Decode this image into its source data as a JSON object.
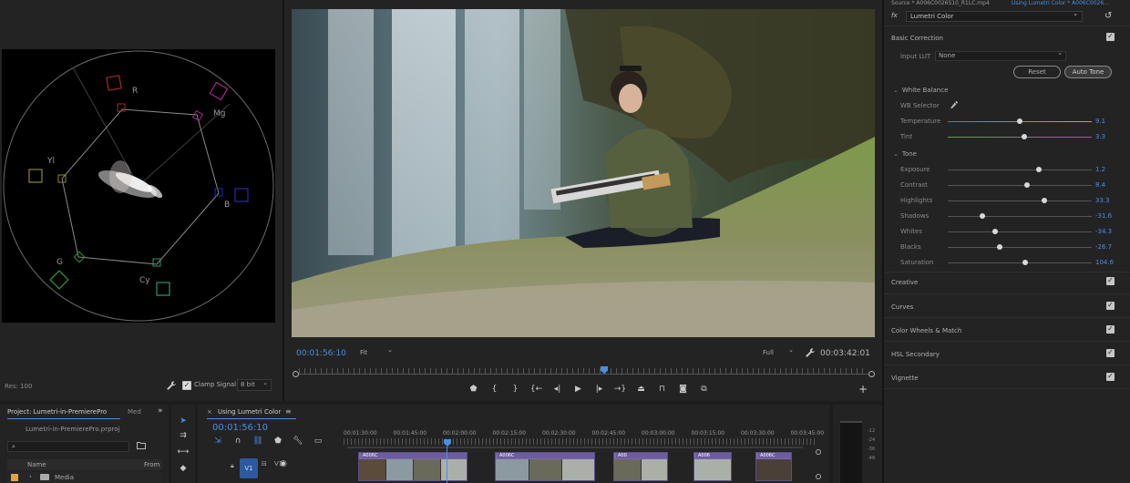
{
  "scope": {
    "labels": {
      "r": "R",
      "mg": "Mg",
      "yl": "Yl",
      "b": "B",
      "g": "G",
      "cy": "Cy"
    },
    "resolution_label": "Res: 100",
    "clamp_label": "Clamp Signal",
    "bit_depth": "8 bit",
    "icons": [
      "wrench-icon",
      "checkbox-icon"
    ]
  },
  "program": {
    "current_timecode": "00:01:56:10",
    "fit_label": "Fit",
    "quality_label": "Full",
    "duration_timecode": "00:03:42:01",
    "transport": [
      "marker-icon",
      "in-point-icon",
      "out-point-icon",
      "go-to-in-icon",
      "step-back-icon",
      "play-icon",
      "step-forward-icon",
      "go-to-out-icon",
      "lift-icon",
      "extract-icon",
      "export-frame-icon",
      "compare-icon"
    ],
    "add_label": "+"
  },
  "lumetri": {
    "source_label": "Source * A006C0026S10_R1LC.mp4",
    "sequence_label": "Using Lumetri Color * A006C0026...",
    "fx_label": "fx",
    "effect_name": "Lumetri Color",
    "sections": {
      "basic_correction": "Basic Correction",
      "input_lut_label": "Input LUT",
      "input_lut_value": "None",
      "reset_label": "Reset",
      "auto_tone_label": "Auto Tone",
      "white_balance": "White Balance",
      "wb_selector": "WB Selector",
      "tone": "Tone",
      "creative": "Creative",
      "curves": "Curves",
      "color_wheels": "Color Wheels & Match",
      "hsl": "HSL Secondary",
      "vignette": "Vignette"
    },
    "params": [
      {
        "label": "Temperature",
        "value": "9.1",
        "position": 0.5
      },
      {
        "label": "Tint",
        "value": "3.3",
        "position": 0.53
      },
      {
        "label": "Exposure",
        "value": "1.2",
        "position": 0.63
      },
      {
        "label": "Contrast",
        "value": "8.4",
        "position": 0.55
      },
      {
        "label": "Highlights",
        "value": "33.3",
        "position": 0.67
      },
      {
        "label": "Shadows",
        "value": "-31.6",
        "position": 0.24
      },
      {
        "label": "Whites",
        "value": "-34.3",
        "position": 0.33
      },
      {
        "label": "Blacks",
        "value": "-26.7",
        "position": 0.36
      },
      {
        "label": "Saturation",
        "value": "104.6",
        "position": 0.54
      }
    ],
    "accent": "#4a8fe0"
  },
  "project": {
    "tab_label": "Project: Lumetri-in-PremierePro",
    "media_tab_label": "Med",
    "more_label": "»",
    "file_label": "Lumetri-in-PremierePro.prproj",
    "col_name": "Name",
    "col_from": "From",
    "folder_name": "Media",
    "folder_color": "#e8a23a"
  },
  "timeline": {
    "close_label": "×",
    "tab_label": "Using Lumetri Color",
    "menu_label": "≡",
    "timecode": "00:01:56:10",
    "ruler": [
      "00:01:30:00",
      "00:01:45:00",
      "00:02:00:00",
      "00:02:15:00",
      "00:02:30:00",
      "00:02:45:00",
      "00:03:00:00",
      "00:03:15:00",
      "00:03:30:00",
      "00:03:45:00"
    ],
    "track_target": "V1",
    "track_name": "V1",
    "clip_labels": [
      "A006C",
      "A006C",
      "A00",
      "A006",
      "A006C",
      "A006C"
    ],
    "clip_color": "#7a6aaa"
  },
  "meter": {
    "scale": [
      "-12",
      "-24",
      "-36",
      "-48"
    ]
  }
}
